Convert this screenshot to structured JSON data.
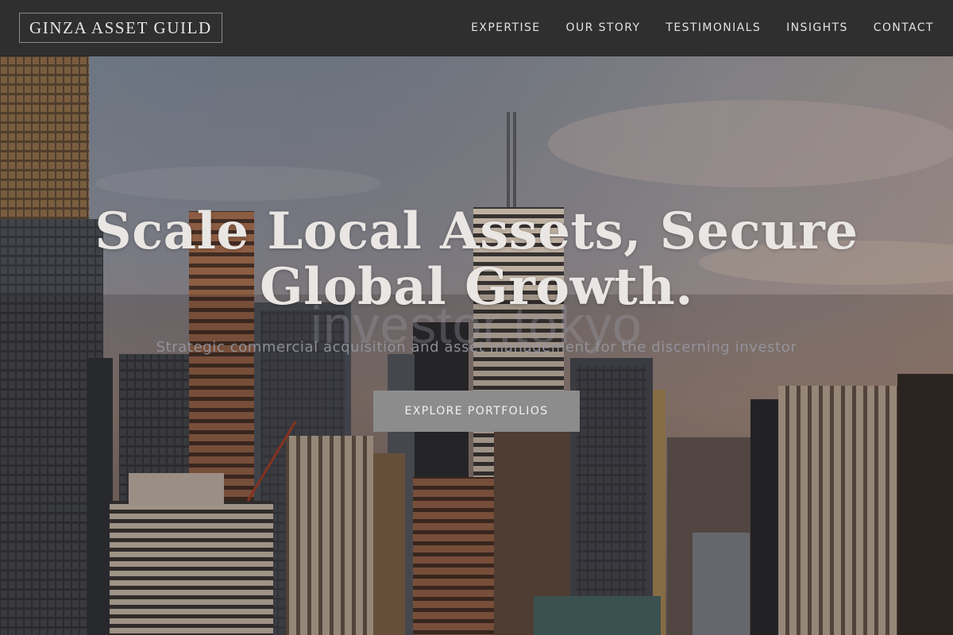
{
  "brand": {
    "name": "GINZA ASSET GUILD"
  },
  "nav": {
    "items": [
      {
        "label": "EXPERTISE"
      },
      {
        "label": "OUR STORY"
      },
      {
        "label": "TESTIMONIALS"
      },
      {
        "label": "INSIGHTS"
      },
      {
        "label": "CONTACT"
      }
    ]
  },
  "hero": {
    "headline_line1": "Scale Local Assets, Secure",
    "headline_line2": "Global Growth.",
    "watermark": "investor.tokyo",
    "subtitle": "Strategic commercial acquisition and asset management for the discerning investor",
    "cta_label": "EXPLORE PORTFOLIOS"
  },
  "colors": {
    "navbar_bg": "#2f2f2f",
    "cta_bg": "#8c8c8c",
    "headline_text": "#e9e6e3"
  }
}
